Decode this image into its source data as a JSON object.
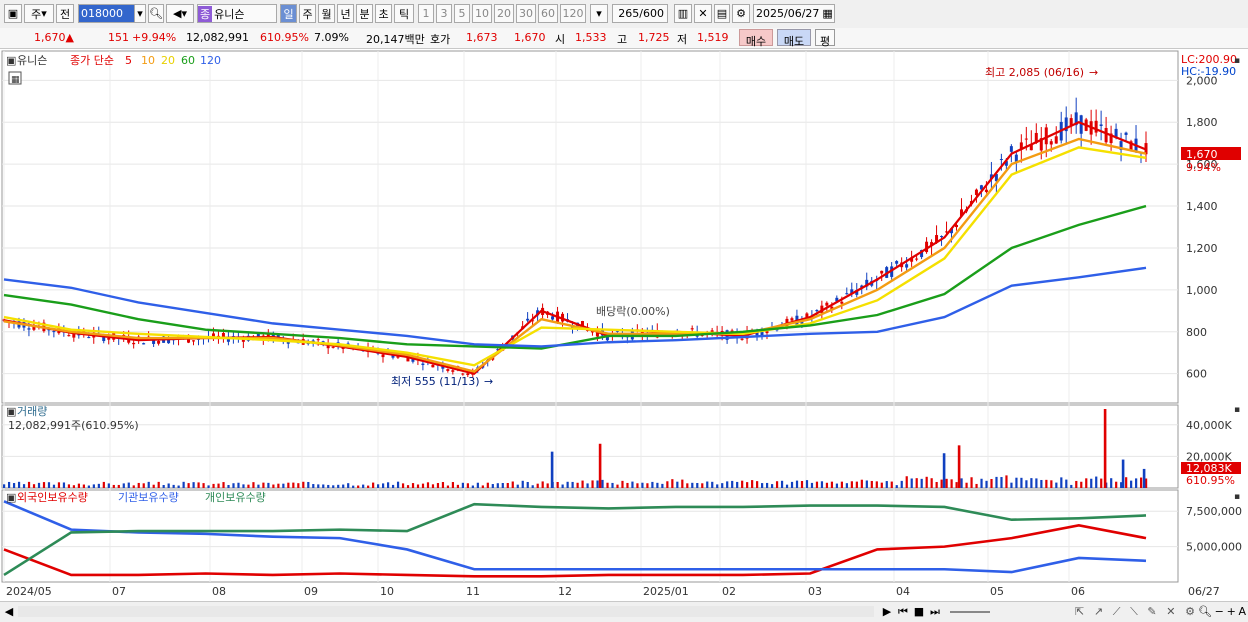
{
  "toolbar": {
    "type_label": "주",
    "prev_label": "전",
    "code": "018000",
    "name_badge": "종",
    "name": "유니슨",
    "periods": [
      "일",
      "주",
      "월",
      "년",
      "분",
      "초",
      "틱"
    ],
    "minutes": [
      "1",
      "3",
      "5",
      "10",
      "20",
      "30",
      "60",
      "120"
    ],
    "count": "265",
    "count_total": "/600",
    "date": "2025/06/27"
  },
  "quote": {
    "price": "1,670▲",
    "change": "151",
    "change_pct": "+9.94%",
    "volume": "12,082,991",
    "vol_ratio": "610.95%",
    "turnover": "7.09%",
    "amount": "20,147백만",
    "bid_label": "호가",
    "bid": "1,673",
    "ask": "1,670",
    "open_label": "시",
    "open": "1,533",
    "high_label": "고",
    "high": "1,725",
    "low_label": "저",
    "low": "1,519",
    "buy_btn": "매수",
    "sell_btn": "매도",
    "eval_btn": "평"
  },
  "price_panel": {
    "name": "유니슨",
    "legend_title": "종가 단순",
    "ma_periods": [
      "5",
      "10",
      "20",
      "60",
      "120"
    ],
    "ma_colors": [
      "#e00000",
      "#f39c12",
      "#f5e000",
      "#1a9e1a",
      "#2f5fe8"
    ],
    "lc": "LC:200.90",
    "hc": "HC:-19.90",
    "current_price": "1,670",
    "current_pct": "9.94%",
    "high_annot": "최고 2,085 (06/16)",
    "low_annot": "최저 555 (11/13)",
    "dividend_annot": "배당락(0.00%)"
  },
  "volume_panel": {
    "title": "거래량",
    "value": "12,082,991주(610.95%)",
    "current": "12,083K",
    "current_pct": "610.95%"
  },
  "holding_panel": {
    "series": [
      "외국인보유수량",
      "기관보유수량",
      "개인보유수량"
    ],
    "colors": [
      "#e00000",
      "#2f5fe8",
      "#2e8b57"
    ]
  },
  "x_labels": [
    "2024/05",
    "07",
    "08",
    "09",
    "10",
    "11",
    "12",
    "2025/01",
    "02",
    "03",
    "04",
    "05",
    "06",
    "06/27"
  ],
  "chart_data": [
    {
      "type": "line",
      "title": "유니슨",
      "y_ticks": [
        600,
        800,
        1000,
        1200,
        1400,
        1600,
        1800,
        2000
      ],
      "ylim": [
        460,
        2140
      ],
      "x": [
        "2024/05",
        "07",
        "08",
        "09",
        "10",
        "11",
        "12",
        "2025/01",
        "02",
        "03",
        "04",
        "05",
        "06",
        "06/27"
      ],
      "series": [
        {
          "name": "5",
          "color": "#e00000",
          "values": [
            855,
            795,
            760,
            770,
            775,
            730,
            680,
            600,
            900,
            780,
            800,
            780,
            870,
            1050,
            1250,
            1650,
            1800,
            1670
          ]
        },
        {
          "name": "10",
          "color": "#f39c12",
          "values": [
            850,
            800,
            770,
            770,
            770,
            735,
            690,
            610,
            860,
            790,
            790,
            790,
            860,
            1000,
            1200,
            1600,
            1720,
            1650
          ]
        },
        {
          "name": "20",
          "color": "#f5e000",
          "values": [
            870,
            810,
            790,
            775,
            760,
            740,
            700,
            640,
            820,
            810,
            800,
            790,
            840,
            950,
            1150,
            1550,
            1680,
            1630
          ]
        },
        {
          "name": "60",
          "color": "#1a9e1a",
          "values": [
            975,
            930,
            860,
            810,
            790,
            770,
            740,
            730,
            720,
            780,
            780,
            800,
            830,
            880,
            980,
            1200,
            1310,
            1400
          ]
        },
        {
          "name": "120",
          "color": "#2f5fe8",
          "values": [
            1050,
            1010,
            940,
            890,
            840,
            810,
            780,
            740,
            730,
            750,
            760,
            775,
            790,
            800,
            870,
            1020,
            1060,
            1105
          ]
        }
      ],
      "annotations": [
        "최고 2,085 (06/16)",
        "최저 555 (11/13)"
      ]
    },
    {
      "type": "bar",
      "title": "거래량",
      "y_ticks": [
        "20,000K",
        "40,000K"
      ],
      "ylim": [
        0,
        50000
      ],
      "spikes_k": [
        {
          "x": "12",
          "v": 23000
        },
        {
          "x": "12",
          "v": 28000
        },
        {
          "x": "04",
          "v": 22000
        },
        {
          "x": "04",
          "v": 27000
        },
        {
          "x": "06",
          "v": 52000
        },
        {
          "x": "06",
          "v": 18000
        },
        {
          "x": "06/27",
          "v": 12083
        }
      ]
    },
    {
      "type": "line",
      "title": "보유수량",
      "y_ticks": [
        "5,000,000",
        "7,500,000"
      ],
      "series": [
        {
          "name": "외국인보유수량",
          "color": "#e00000",
          "values": [
            4800000,
            3000000,
            3000000,
            3100000,
            3000000,
            3100000,
            3000000,
            2900000,
            2900000,
            3000000,
            3000000,
            3000000,
            3100000,
            4800000,
            5000000,
            5600000,
            6500000,
            5600000
          ]
        },
        {
          "name": "기관보유수량",
          "color": "#2f5fe8",
          "values": [
            8200000,
            6200000,
            6000000,
            5900000,
            5700000,
            5600000,
            4800000,
            3400000,
            3400000,
            3400000,
            3400000,
            3400000,
            3400000,
            3400000,
            3400000,
            3200000,
            4200000,
            4000000
          ]
        },
        {
          "name": "개인보유수량",
          "color": "#2e8b57",
          "values": [
            3000000,
            6000000,
            6100000,
            6100000,
            6100000,
            6200000,
            6100000,
            8000000,
            7800000,
            7700000,
            7800000,
            7800000,
            7900000,
            7900000,
            7800000,
            6900000,
            7000000,
            7200000
          ]
        }
      ]
    }
  ]
}
